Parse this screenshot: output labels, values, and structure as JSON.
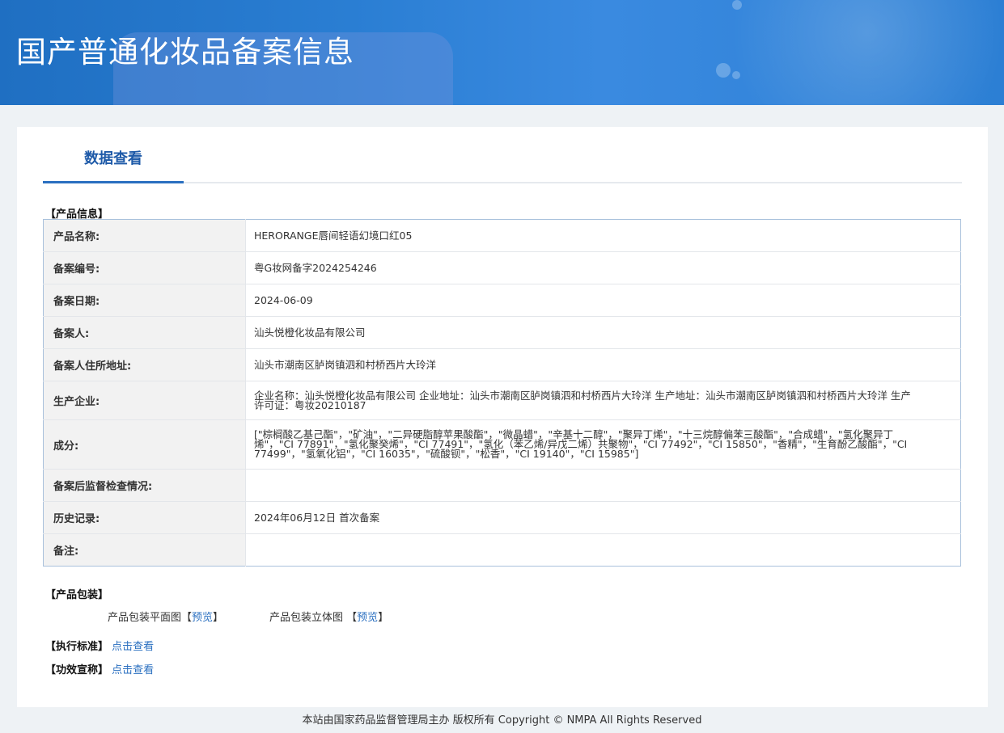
{
  "header": {
    "title": "国产普通化妆品备案信息"
  },
  "tab": {
    "label": "数据查看"
  },
  "product_section": {
    "title": "【产品信息】"
  },
  "info_rows": [
    {
      "key": "产品名称:",
      "value": "HERORANGE唇间轻语幻境口红05"
    },
    {
      "key": "备案编号:",
      "value": "粤G妆网备字2024254246"
    },
    {
      "key": "备案日期:",
      "value": "2024-06-09"
    },
    {
      "key": "备案人:",
      "value": "汕头悦橙化妆品有限公司"
    },
    {
      "key": "备案人住所地址:",
      "value": "汕头市潮南区胪岗镇泗和村桥西片大玲洋"
    },
    {
      "key": "生产企业:",
      "value": "企业名称：汕头悦橙化妆品有限公司 企业地址：汕头市潮南区胪岗镇泗和村桥西片大玲洋 生产地址：汕头市潮南区胪岗镇泗和村桥西片大玲洋 生产许可证：粤妆20210187"
    },
    {
      "key": "成分:",
      "value": "[\"棕榈酸乙基己酯\"，\"矿油\"，\"二异硬脂醇苹果酸酯\"，\"微晶蜡\"，\"辛基十二醇\"，\"聚异丁烯\"，\"十三烷醇偏苯三酸酯\"，\"合成蜡\"，\"氢化聚异丁烯\"，\"CI 77891\"，\"氢化聚癸烯\"，\"CI 77491\"，\"氢化（苯乙烯/异戊二烯）共聚物\"，\"CI 77492\"，\"CI 15850\"，\"香精\"，\"生育酚乙酸酯\"，\"CI 77499\"，\"氢氧化铝\"，\"CI 16035\"，\"硫酸钡\"，\"松香\"，\"CI 19140\"，\"CI 15985\"]"
    },
    {
      "key": "备案后监督检查情况:",
      "value": ""
    },
    {
      "key": "历史记录:",
      "value": "2024年06月12日 首次备案"
    },
    {
      "key": "备注:",
      "value": ""
    }
  ],
  "packaging": {
    "title": "【产品包装】",
    "flat_label": "产品包装平面图",
    "flat_link": "预览",
    "stereo_label": "产品包装立体图",
    "stereo_link": "预览",
    "bracket_open": "【",
    "bracket_close": "】"
  },
  "standard": {
    "label": "【执行标准】",
    "link": "点击查看"
  },
  "efficacy": {
    "label": "【功效宣称】",
    "link": "点击查看"
  },
  "footer": {
    "text": "本站由国家药品监督管理局主办 版权所有 Copyright © NMPA All Rights Reserved"
  }
}
